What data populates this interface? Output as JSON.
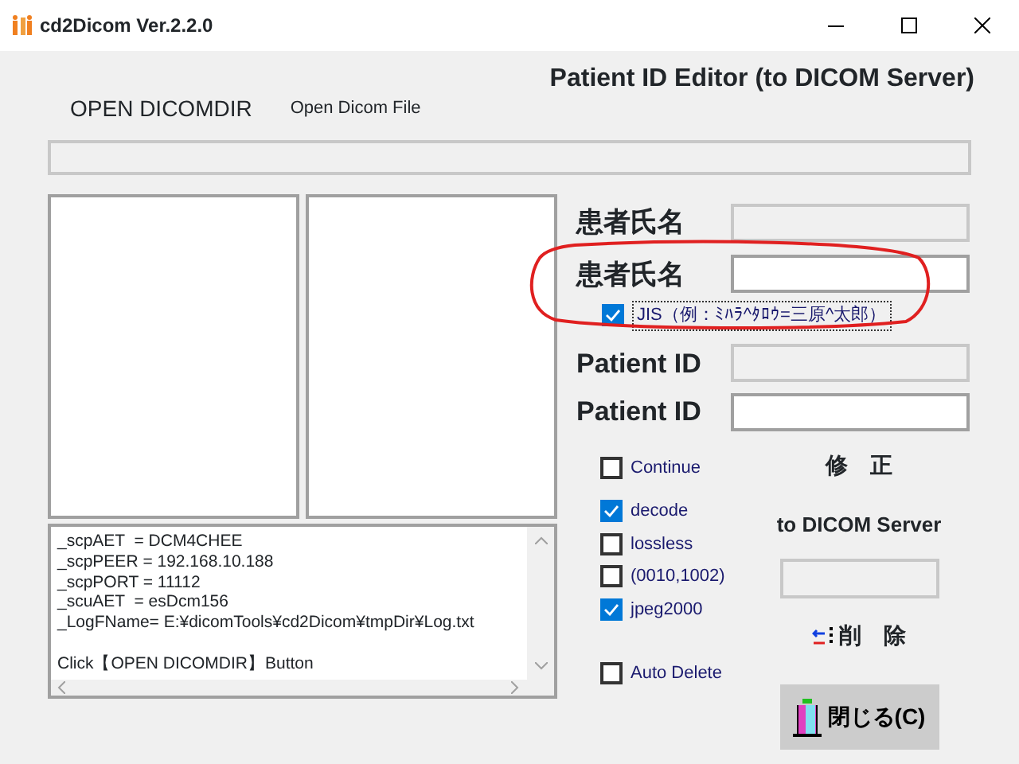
{
  "window": {
    "title": "cd2Dicom Ver.2.2.0"
  },
  "header": {
    "open_dicomdir": "OPEN DICOMDIR",
    "open_dicom_file": "Open Dicom File",
    "title": "Patient ID Editor  (to DICOM Server)"
  },
  "log": {
    "settings": [
      "_scpAET  = DCM4CHEE",
      "_scpPEER = 192.168.10.188",
      "_scpPORT = 11112",
      "_scuAET  = esDcm156",
      "_LogFName= E:¥dicomTools¥cd2Dicom¥tmpDir¥Log.txt"
    ],
    "message": "Click【OPEN DICOMDIR】Button"
  },
  "editor_rows": [
    {
      "kind": "field",
      "label": "患者氏名",
      "disabled": true
    },
    {
      "kind": "field",
      "label": "患者氏名",
      "disabled": false
    },
    {
      "kind": "checkbox",
      "label": "JIS（例：ﾐﾊﾗ^ﾀﾛｳ=三原^太郎）",
      "checked": true
    },
    {
      "kind": "field",
      "label": "Patient ID",
      "disabled": true
    },
    {
      "kind": "field",
      "label": "Patient ID",
      "disabled": false
    }
  ],
  "options": [
    {
      "label": "Continue",
      "checked": false
    },
    {
      "label": "decode",
      "checked": true
    },
    {
      "label": "lossless",
      "checked": false
    },
    {
      "label": "(0010,1002)",
      "checked": false
    },
    {
      "label": "jpeg2000",
      "checked": true
    },
    {
      "label": "Auto Delete",
      "checked": false
    }
  ],
  "actions": {
    "modify": "修　正",
    "send_label": "to DICOM Server",
    "delete": "削　除",
    "close": "閉じる(C)"
  }
}
